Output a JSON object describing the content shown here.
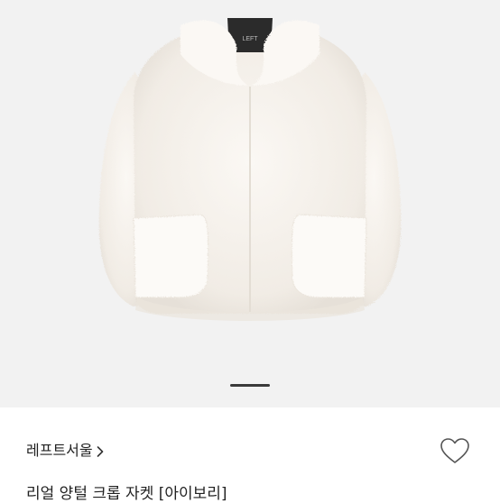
{
  "product": {
    "brand": "레프트서울",
    "title": "리얼 양털 크롭 자켓 [아이보리]",
    "collar_tag_text": "LEFT",
    "image_background": "#f2f2f2",
    "garment_color": "#f7f3ee"
  },
  "carousel": {
    "current_index": 1
  },
  "icons": {
    "brand_chevron": "chevron-right-icon",
    "wishlist": "heart-outline-icon"
  }
}
